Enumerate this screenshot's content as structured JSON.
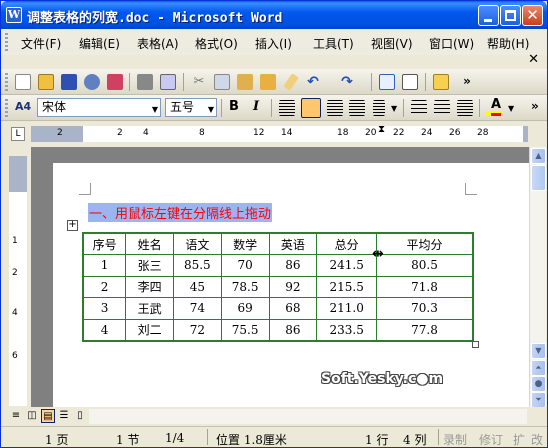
{
  "window": {
    "title": "调整表格的列宽.doc - Microsoft Word",
    "app_icon_letter": "W"
  },
  "menu": [
    {
      "id": "file",
      "label": "文件(F)"
    },
    {
      "id": "edit",
      "label": "编辑(E)"
    },
    {
      "id": "table",
      "label": "表格(A)"
    },
    {
      "id": "format",
      "label": "格式(O)"
    },
    {
      "id": "insert",
      "label": "插入(I)"
    },
    {
      "id": "tools",
      "label": "工具(T)"
    },
    {
      "id": "view",
      "label": "视图(V)"
    },
    {
      "id": "window",
      "label": "窗口(W)"
    },
    {
      "id": "help",
      "label": "帮助(H)"
    }
  ],
  "format_toolbar": {
    "style_icon": "A4",
    "font_name": "宋体",
    "font_size": "五号",
    "bold_label": "B",
    "italic_label": "I",
    "font_color_label": "A"
  },
  "ruler": {
    "corner_label": "L",
    "h_numbers": [
      "2",
      "2",
      "4",
      "8",
      "12",
      "14",
      "18",
      "20",
      "22",
      "24",
      "26",
      "28"
    ],
    "v_numbers": [
      "1",
      "2",
      "4",
      "6"
    ]
  },
  "document": {
    "heading": "一、用鼠标左键在分隔线上拖动",
    "table": {
      "headers": [
        "序号",
        "姓名",
        "语文",
        "数学",
        "英语",
        "总分",
        "平均分"
      ],
      "rows": [
        [
          "1",
          "张三",
          "85.5",
          "70",
          "86",
          "241.5",
          "80.5"
        ],
        [
          "2",
          "李四",
          "45",
          "78.5",
          "92",
          "215.5",
          "71.8"
        ],
        [
          "3",
          "王武",
          "74",
          "69",
          "68",
          "211.0",
          "70.3"
        ],
        [
          "4",
          "刘二",
          "72",
          "75.5",
          "86",
          "233.5",
          "77.8"
        ]
      ]
    },
    "watermark": "Soft.Yesky.c●m"
  },
  "statusbar": {
    "page": "1 页",
    "section": "1 节",
    "page_of": "1/4",
    "position": "位置 1.8厘米",
    "line": "1 行",
    "column": "4 列",
    "rec": "录制",
    "trk": "修订",
    "ext": "扩",
    "ovr": "改"
  }
}
